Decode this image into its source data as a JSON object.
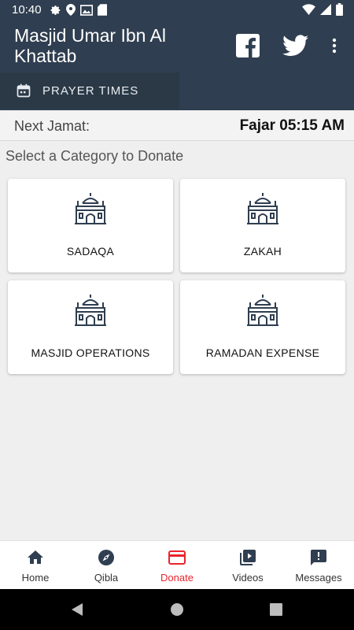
{
  "status_bar": {
    "time": "10:40"
  },
  "app": {
    "title": "Masjid Umar Ibn Al Khattab",
    "tab_label": "PRAYER TIMES"
  },
  "next_jamat": {
    "label": "Next Jamat:",
    "value": "Fajar 05:15 AM"
  },
  "donate": {
    "heading": "Select a Category to Donate",
    "categories": [
      {
        "label": "SADAQA",
        "icon": "mosque-icon"
      },
      {
        "label": "ZAKAH",
        "icon": "mosque-icon"
      },
      {
        "label": "MASJID OPERATIONS",
        "icon": "mosque-icon"
      },
      {
        "label": "RAMADAN EXPENSE",
        "icon": "mosque-icon"
      }
    ]
  },
  "bottom_nav": {
    "items": [
      {
        "label": "Home",
        "icon": "home-icon"
      },
      {
        "label": "Qibla",
        "icon": "compass-icon"
      },
      {
        "label": "Donate",
        "icon": "card-icon",
        "active": true
      },
      {
        "label": "Videos",
        "icon": "video-library-icon"
      },
      {
        "label": "Messages",
        "icon": "message-icon"
      }
    ]
  },
  "colors": {
    "header": "#2f3e50",
    "accent": "#e8252e",
    "background": "#efefef",
    "icon_dark": "#2f3e50"
  }
}
